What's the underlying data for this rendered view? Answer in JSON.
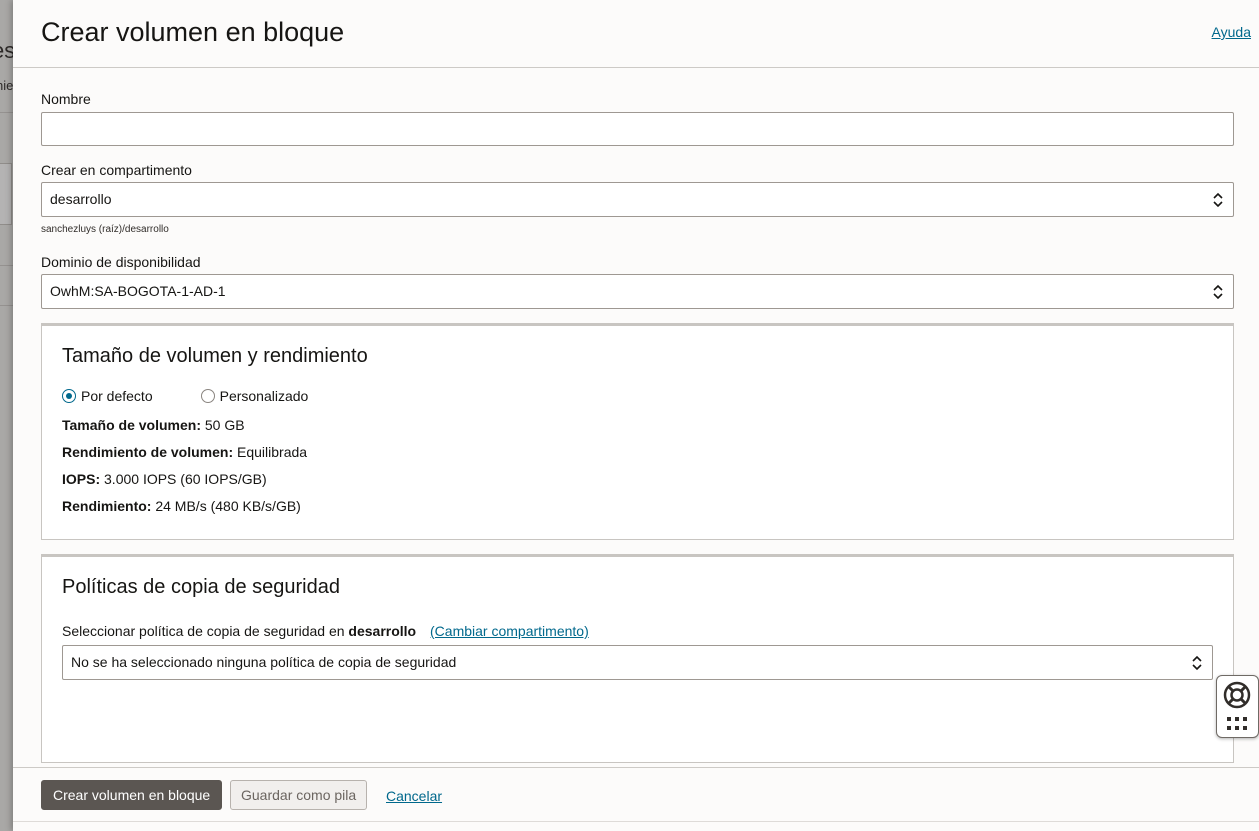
{
  "background": {
    "title_fragment": "es",
    "sub_fragment": "nie"
  },
  "panel": {
    "title": "Crear volumen en bloque",
    "help_link": "Ayuda"
  },
  "form": {
    "name_label": "Nombre",
    "name_value": "",
    "compartment_label": "Crear en compartimento",
    "compartment_value": "desarrollo",
    "compartment_path": "sanchezluys (raíz)/desarrollo",
    "ad_label": "Dominio de disponibilidad",
    "ad_value": "OwhM:SA-BOGOTA-1-AD-1"
  },
  "performance": {
    "title": "Tamaño de volumen y rendimiento",
    "radio_default": "Por defecto",
    "radio_custom": "Personalizado",
    "selected": "default",
    "size_label": "Tamaño de volumen:",
    "size_value": "50 GB",
    "perf_label": "Rendimiento de volumen:",
    "perf_value": "Equilibrada",
    "iops_label": "IOPS:",
    "iops_value": "3.000 IOPS (60 IOPS/GB)",
    "throughput_label": "Rendimiento:",
    "throughput_value": "24 MB/s (480 KB/s/GB)"
  },
  "backup": {
    "title": "Políticas de copia de seguridad",
    "select_label": "Seleccionar política de copia de seguridad en",
    "compartment": "desarrollo",
    "change_link": "(Cambiar compartimento)",
    "policy_value": "No se ha seleccionado ninguna política de copia de seguridad"
  },
  "footer": {
    "create_button": "Crear volumen en bloque",
    "save_stack_button": "Guardar como pila",
    "cancel_link": "Cancelar"
  },
  "colors": {
    "link": "#00688c",
    "primary_button": "#5b5652",
    "radio_selected": "#00688c"
  },
  "icons": {
    "help_float": "lifebuoy-icon",
    "apps_float": "grid-icon",
    "select_chevron": "chevron-up-down-icon"
  }
}
